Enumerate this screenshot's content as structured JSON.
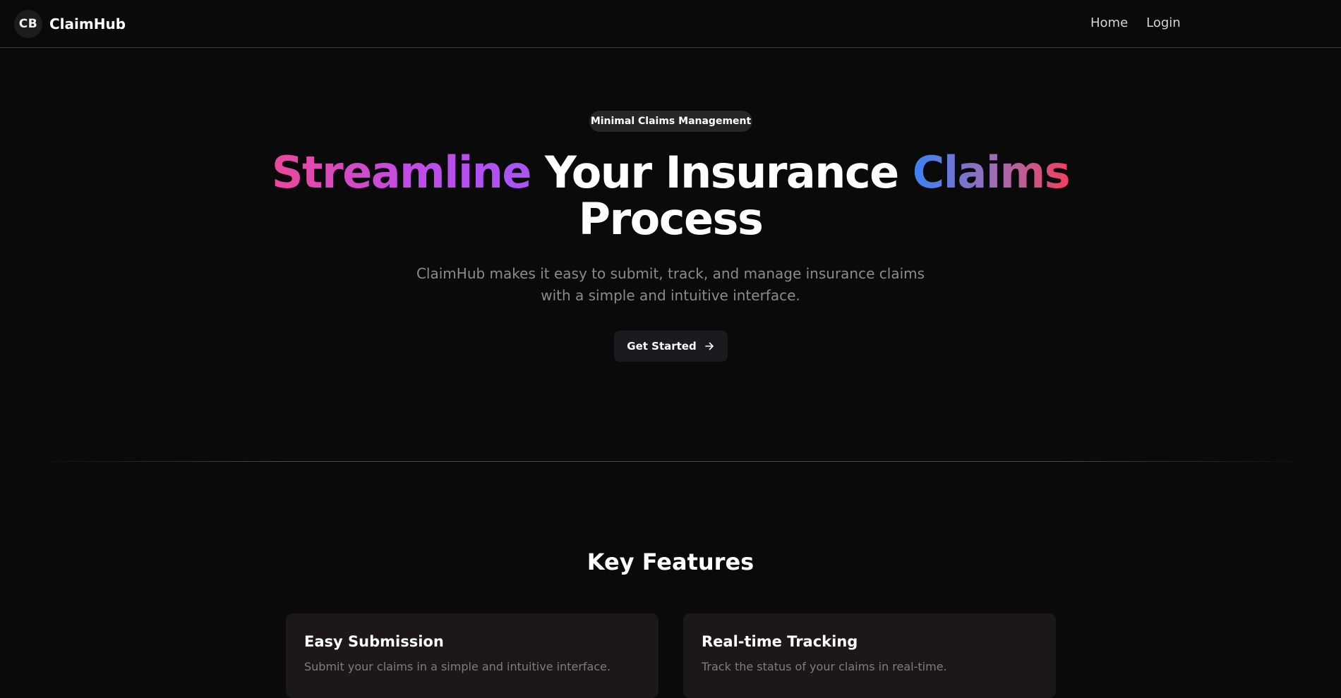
{
  "nav": {
    "logo_initials": "CB",
    "brand_name": "ClaimHub",
    "links": [
      {
        "label": "Home"
      },
      {
        "label": "Login"
      }
    ]
  },
  "hero": {
    "badge": "Minimal Claims Management",
    "headline": {
      "word_1": "Streamline",
      "middle": "Your Insurance",
      "word_2": "Claims",
      "line_2": "Process"
    },
    "subtitle": "ClaimHub makes it easy to submit, track, and manage insurance claims with a simple and intuitive interface.",
    "cta_label": "Get Started",
    "cta_icon": "arrow-right-icon"
  },
  "features": {
    "title": "Key Features",
    "items": [
      {
        "title": "Easy Submission",
        "description": "Submit your claims in a simple and intuitive interface."
      },
      {
        "title": "Real-time Tracking",
        "description": "Track the status of your claims in real-time."
      }
    ]
  },
  "colors": {
    "background": "#0a0a0a",
    "gradient_1": [
      "#ec4899",
      "#a855f7"
    ],
    "gradient_2": [
      "#3b82f6",
      "#f43f5e"
    ],
    "card_background": "#1c1819",
    "muted_text": "#8a8a90"
  }
}
